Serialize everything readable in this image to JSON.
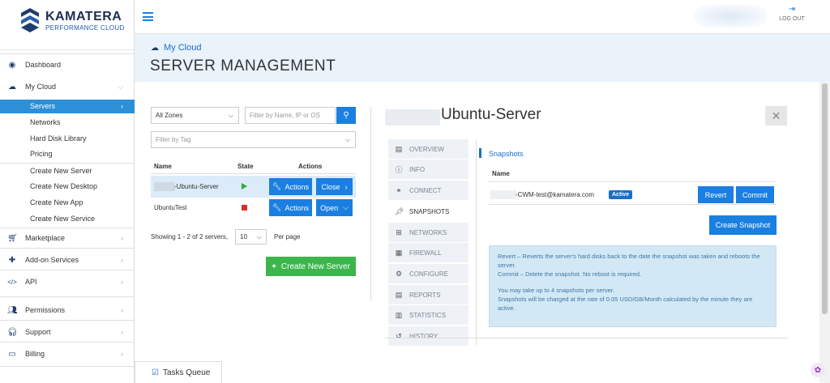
{
  "brand": {
    "name": "KAMATERA",
    "tagline": "PERFORMANCE CLOUD"
  },
  "topbar": {
    "logout": "LOG OUT"
  },
  "header": {
    "breadcrumb": "My Cloud",
    "title": "SERVER MANAGEMENT"
  },
  "sidebar": {
    "items": [
      {
        "label": "Dashboard",
        "icon": "dashboard-icon"
      },
      {
        "label": "My Cloud",
        "icon": "cloud-icon"
      },
      {
        "label": "Marketplace",
        "icon": "cart-icon"
      },
      {
        "label": "Add-on Services",
        "icon": "puzzle-icon"
      },
      {
        "label": "API",
        "icon": "code-icon"
      },
      {
        "label": "Permissions",
        "icon": "users-icon"
      },
      {
        "label": "Support",
        "icon": "headset-icon"
      },
      {
        "label": "Billing",
        "icon": "billing-icon"
      }
    ],
    "sub": [
      "Servers",
      "Networks",
      "Hard Disk Library",
      "Pricing"
    ],
    "create": [
      "Create New Server",
      "Create New Desktop",
      "Create New App",
      "Create New Service"
    ]
  },
  "filters": {
    "zone": "All Zones",
    "search_placeholder": "Filter by Name, IP or OS",
    "tag_placeholder": "Filter by Tag"
  },
  "table": {
    "headers": [
      "Name",
      "State",
      "Actions"
    ],
    "rows": [
      {
        "name": "-Ubuntu-Server",
        "actions": "Actions",
        "second": "Close",
        "state_color": "#2eaa3a"
      },
      {
        "name": "UbuntuTest",
        "actions": "Actions",
        "second": "Open",
        "state_color": "#d9302c"
      }
    ],
    "showing": "Showing 1 - 2 of 2 servers,",
    "per_page_value": "10",
    "per_page": "Per page"
  },
  "create_button": "Create New Server",
  "detail": {
    "server_name": "Ubuntu-Server",
    "tabs": [
      {
        "label": "OVERVIEW",
        "icon": "document-icon"
      },
      {
        "label": "INFO",
        "icon": "info-icon"
      },
      {
        "label": "CONNECT",
        "icon": "link-icon"
      },
      {
        "label": "SNAPSHOTS",
        "icon": "pin-icon"
      },
      {
        "label": "NETWORKS",
        "icon": "network-icon"
      },
      {
        "label": "FIREWALL",
        "icon": "firewall-icon"
      },
      {
        "label": "CONFIGURE",
        "icon": "gears-icon"
      },
      {
        "label": "REPORTS",
        "icon": "reports-icon"
      },
      {
        "label": "STATISTICS",
        "icon": "statistics-icon"
      },
      {
        "label": "HISTORY",
        "icon": "history-icon"
      }
    ],
    "section": "Snapshots",
    "col_name": "Name",
    "snapshot": {
      "name": "-CWM-test@kamatera.com",
      "badge": "Active",
      "revert": "Revert",
      "commit": "Commit"
    },
    "create_snapshot": "Create Snapshot",
    "info": {
      "l1": "Revert – Reverts the server's hard disks back to the date the snapshot was taken and reboots the server.",
      "l2": "Commit – Delete the snapshot. No reboot is required.",
      "l3": "You may take up to 4 snapshots per server.",
      "l4": "Snapshots will be charged at the rate of 0.05 USD/GB/Month calculated by the minute they are active."
    }
  },
  "tasks": "Tasks Queue"
}
